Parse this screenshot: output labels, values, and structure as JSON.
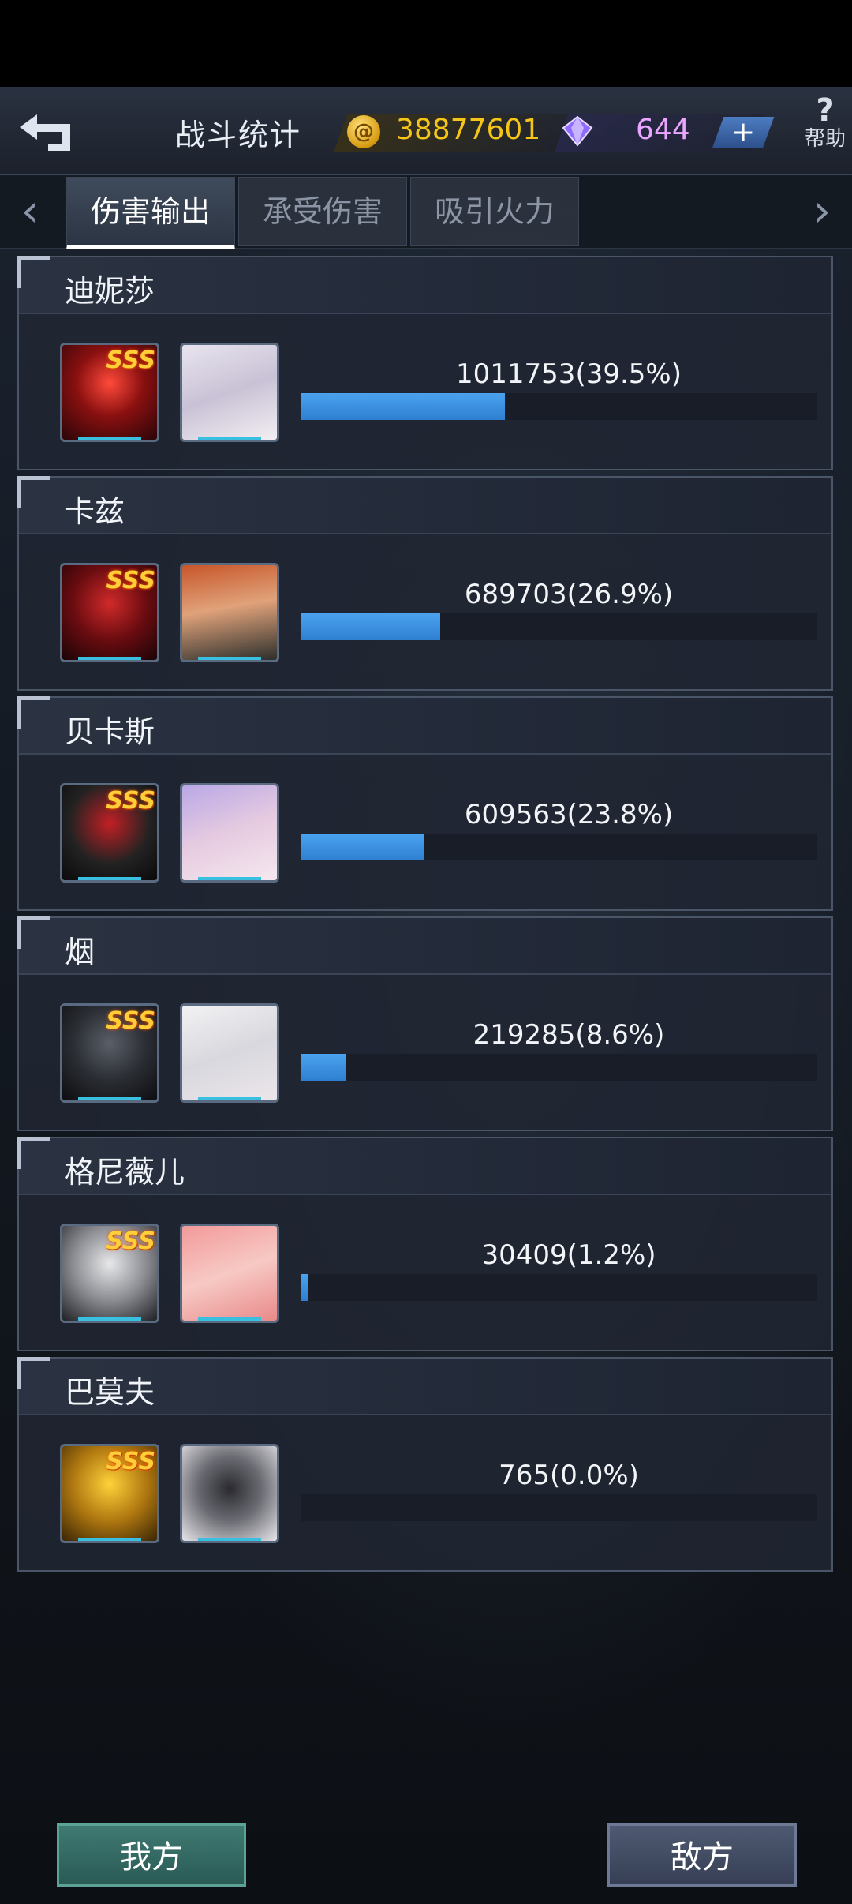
{
  "header": {
    "title": "战斗统计",
    "coins": "38877601",
    "gems": "644",
    "plus_label": "+",
    "help_label": "帮助"
  },
  "tabs": [
    {
      "label": "伤害输出",
      "active": true
    },
    {
      "label": "承受伤害",
      "active": false
    },
    {
      "label": "吸引火力",
      "active": false
    }
  ],
  "rows": [
    {
      "name": "迪妮莎",
      "value": "1011753(39.5%)",
      "percent": 39.5,
      "rank": "SSS"
    },
    {
      "name": "卡兹",
      "value": "689703(26.9%)",
      "percent": 26.9,
      "rank": "SSS"
    },
    {
      "name": "贝卡斯",
      "value": "609563(23.8%)",
      "percent": 23.8,
      "rank": "SSS"
    },
    {
      "name": "烟",
      "value": "219285(8.6%)",
      "percent": 8.6,
      "rank": "SSS"
    },
    {
      "name": "格尼薇儿",
      "value": "30409(1.2%)",
      "percent": 1.2,
      "rank": "SSS"
    },
    {
      "name": "巴莫夫",
      "value": "765(0.0%)",
      "percent": 0.0,
      "rank": "SSS"
    }
  ],
  "buttons": {
    "mine": "我方",
    "enemy": "敌方"
  },
  "colors": {
    "bar": "#3a92e0",
    "coin_text": "#f5c518",
    "gem_text": "#eaa6ff"
  }
}
